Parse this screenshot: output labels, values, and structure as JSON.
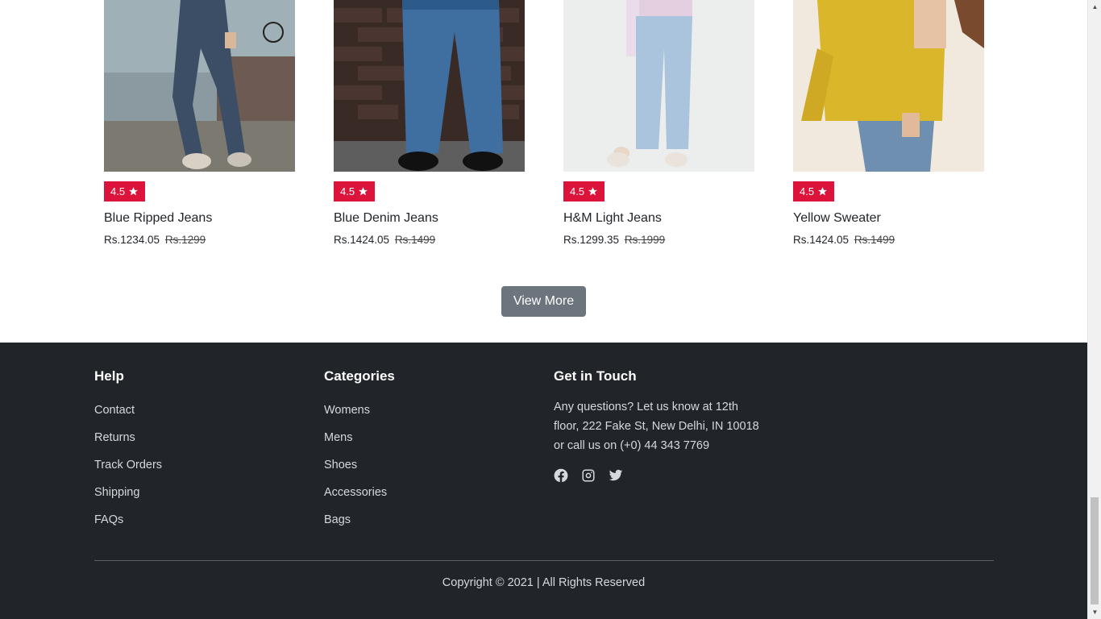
{
  "products": [
    {
      "name": "Blue Ripped Jeans",
      "rating": "4.5",
      "price": "Rs.1234.05",
      "old_price": "Rs.1299"
    },
    {
      "name": "Blue Denim Jeans",
      "rating": "4.5",
      "price": "Rs.1424.05",
      "old_price": "Rs.1499"
    },
    {
      "name": "H&M Light Jeans",
      "rating": "4.5",
      "price": "Rs.1299.35",
      "old_price": "Rs.1999"
    },
    {
      "name": "Yellow Sweater",
      "rating": "4.5",
      "price": "Rs.1424.05",
      "old_price": "Rs.1499"
    }
  ],
  "view_more_label": "View More",
  "footer": {
    "help": {
      "title": "Help",
      "links": [
        "Contact",
        "Returns",
        "Track Orders",
        "Shipping",
        "FAQs"
      ]
    },
    "categories": {
      "title": "Categories",
      "links": [
        "Womens",
        "Mens",
        "Shoes",
        "Accessories",
        "Bags"
      ]
    },
    "contact": {
      "title": "Get in Touch",
      "text": "Any questions? Let us know at 12th floor, 222 Fake St, New Delhi, IN 10018 or call us on (+0) 44 343 7769",
      "socials": [
        "facebook-icon",
        "instagram-icon",
        "twitter-icon"
      ]
    },
    "copyright": "Copyright © 2021 | All Rights Reserved"
  },
  "colors": {
    "rating_badge": "#dc143c",
    "button": "#6c757d",
    "footer_bg": "#212529"
  }
}
